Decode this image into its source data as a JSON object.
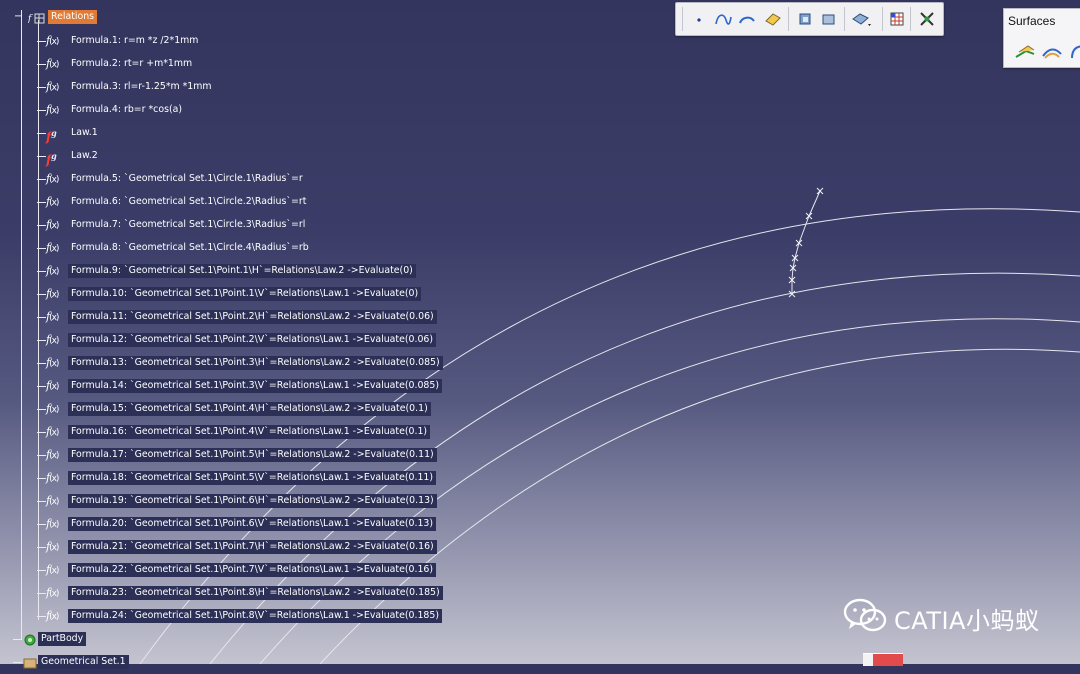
{
  "tree": {
    "relations": {
      "label": "Relations"
    },
    "items": [
      {
        "kind": "formula",
        "label": "Formula.1: r=m *z /2*1mm",
        "highlight": false
      },
      {
        "kind": "formula",
        "label": "Formula.2: rt=r +m*1mm",
        "highlight": false
      },
      {
        "kind": "formula",
        "label": "Formula.3: rl=r-1.25*m *1mm",
        "highlight": false
      },
      {
        "kind": "formula",
        "label": "Formula.4: rb=r *cos(a)",
        "highlight": false
      },
      {
        "kind": "law",
        "label": "Law.1",
        "highlight": false
      },
      {
        "kind": "law",
        "label": "Law.2",
        "highlight": false
      },
      {
        "kind": "formula",
        "label": "Formula.5: `Geometrical Set.1\\Circle.1\\Radius`=r",
        "highlight": false
      },
      {
        "kind": "formula",
        "label": "Formula.6: `Geometrical Set.1\\Circle.2\\Radius`=rt",
        "highlight": false
      },
      {
        "kind": "formula",
        "label": "Formula.7: `Geometrical Set.1\\Circle.3\\Radius`=rl",
        "highlight": false
      },
      {
        "kind": "formula",
        "label": "Formula.8: `Geometrical Set.1\\Circle.4\\Radius`=rb",
        "highlight": false
      },
      {
        "kind": "formula",
        "label": "Formula.9: `Geometrical Set.1\\Point.1\\H`=Relations\\Law.2 ->Evaluate(0)",
        "highlight": true
      },
      {
        "kind": "formula",
        "label": "Formula.10: `Geometrical Set.1\\Point.1\\V`=Relations\\Law.1 ->Evaluate(0)",
        "highlight": true
      },
      {
        "kind": "formula",
        "label": "Formula.11: `Geometrical Set.1\\Point.2\\H`=Relations\\Law.2 ->Evaluate(0.06)",
        "highlight": true
      },
      {
        "kind": "formula",
        "label": "Formula.12: `Geometrical Set.1\\Point.2\\V`=Relations\\Law.1 ->Evaluate(0.06)",
        "highlight": true
      },
      {
        "kind": "formula",
        "label": "Formula.13: `Geometrical Set.1\\Point.3\\H`=Relations\\Law.2 ->Evaluate(0.085)",
        "highlight": true
      },
      {
        "kind": "formula",
        "label": "Formula.14: `Geometrical Set.1\\Point.3\\V`=Relations\\Law.1 ->Evaluate(0.085)",
        "highlight": true
      },
      {
        "kind": "formula",
        "label": "Formula.15: `Geometrical Set.1\\Point.4\\H`=Relations\\Law.2 ->Evaluate(0.1)",
        "highlight": true
      },
      {
        "kind": "formula",
        "label": "Formula.16: `Geometrical Set.1\\Point.4\\V`=Relations\\Law.1 ->Evaluate(0.1)",
        "highlight": true
      },
      {
        "kind": "formula",
        "label": "Formula.17: `Geometrical Set.1\\Point.5\\H`=Relations\\Law.2 ->Evaluate(0.11)",
        "highlight": true
      },
      {
        "kind": "formula",
        "label": "Formula.18: `Geometrical Set.1\\Point.5\\V`=Relations\\Law.1 ->Evaluate(0.11)",
        "highlight": true
      },
      {
        "kind": "formula",
        "label": "Formula.19: `Geometrical Set.1\\Point.6\\H`=Relations\\Law.2 ->Evaluate(0.13)",
        "highlight": true
      },
      {
        "kind": "formula",
        "label": "Formula.20: `Geometrical Set.1\\Point.6\\V`=Relations\\Law.1 ->Evaluate(0.13)",
        "highlight": true
      },
      {
        "kind": "formula",
        "label": "Formula.21: `Geometrical Set.1\\Point.7\\H`=Relations\\Law.2 ->Evaluate(0.16)",
        "highlight": true
      },
      {
        "kind": "formula",
        "label": "Formula.22: `Geometrical Set.1\\Point.7\\V`=Relations\\Law.1 ->Evaluate(0.16)",
        "highlight": true
      },
      {
        "kind": "formula",
        "label": "Formula.23: `Geometrical Set.1\\Point.8\\H`=Relations\\Law.2 ->Evaluate(0.185)",
        "highlight": true
      },
      {
        "kind": "formula",
        "label": "Formula.24: `Geometrical Set.1\\Point.8\\V`=Relations\\Law.1 ->Evaluate(0.185)",
        "highlight": true
      }
    ],
    "partbody": {
      "label": "PartBody"
    },
    "geometrical_set": {
      "label": "Geometrical Set.1"
    }
  },
  "toolbar": {
    "icons": [
      "point-icon",
      "spline-icon",
      "circle-arc-icon",
      "fill-surface-icon",
      "extrude-icon",
      "offset-icon",
      "join-icon",
      "grid-icon",
      "tools-icon"
    ]
  },
  "surfaces_toolbar": {
    "title": "Surfaces",
    "icons": [
      "extrude-surface-icon",
      "sweep-surface-icon",
      "revolve-surface-icon"
    ]
  },
  "watermark": {
    "text": "CATIA小蚂蚁",
    "icon": "wechat-icon"
  },
  "colors": {
    "background_top": "#34355e",
    "relations_highlight": "#e07a34",
    "tree_text": "#ffffff",
    "law_icon": "#ff3b30"
  }
}
